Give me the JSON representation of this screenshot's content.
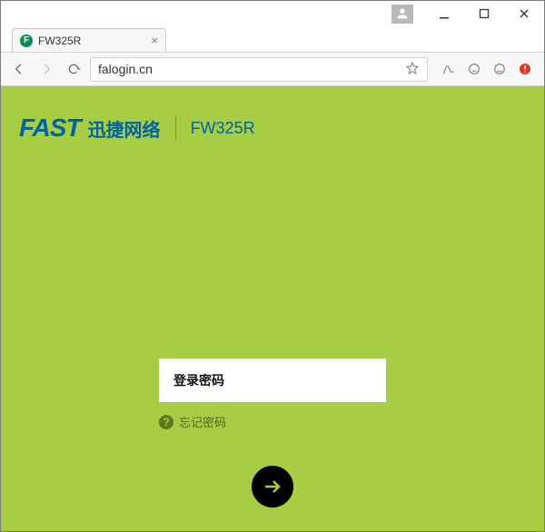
{
  "window": {
    "avatar_label": "user"
  },
  "tabs": [
    {
      "title": "FW325R",
      "favicon_letter": "F"
    }
  ],
  "omnibox": {
    "url": "falogin.cn"
  },
  "page": {
    "brand": {
      "fast": "FAST",
      "cn": "迅捷网络",
      "model": "FW325R"
    },
    "password_placeholder": "登录密码",
    "forgot_label": "忘记密码"
  }
}
